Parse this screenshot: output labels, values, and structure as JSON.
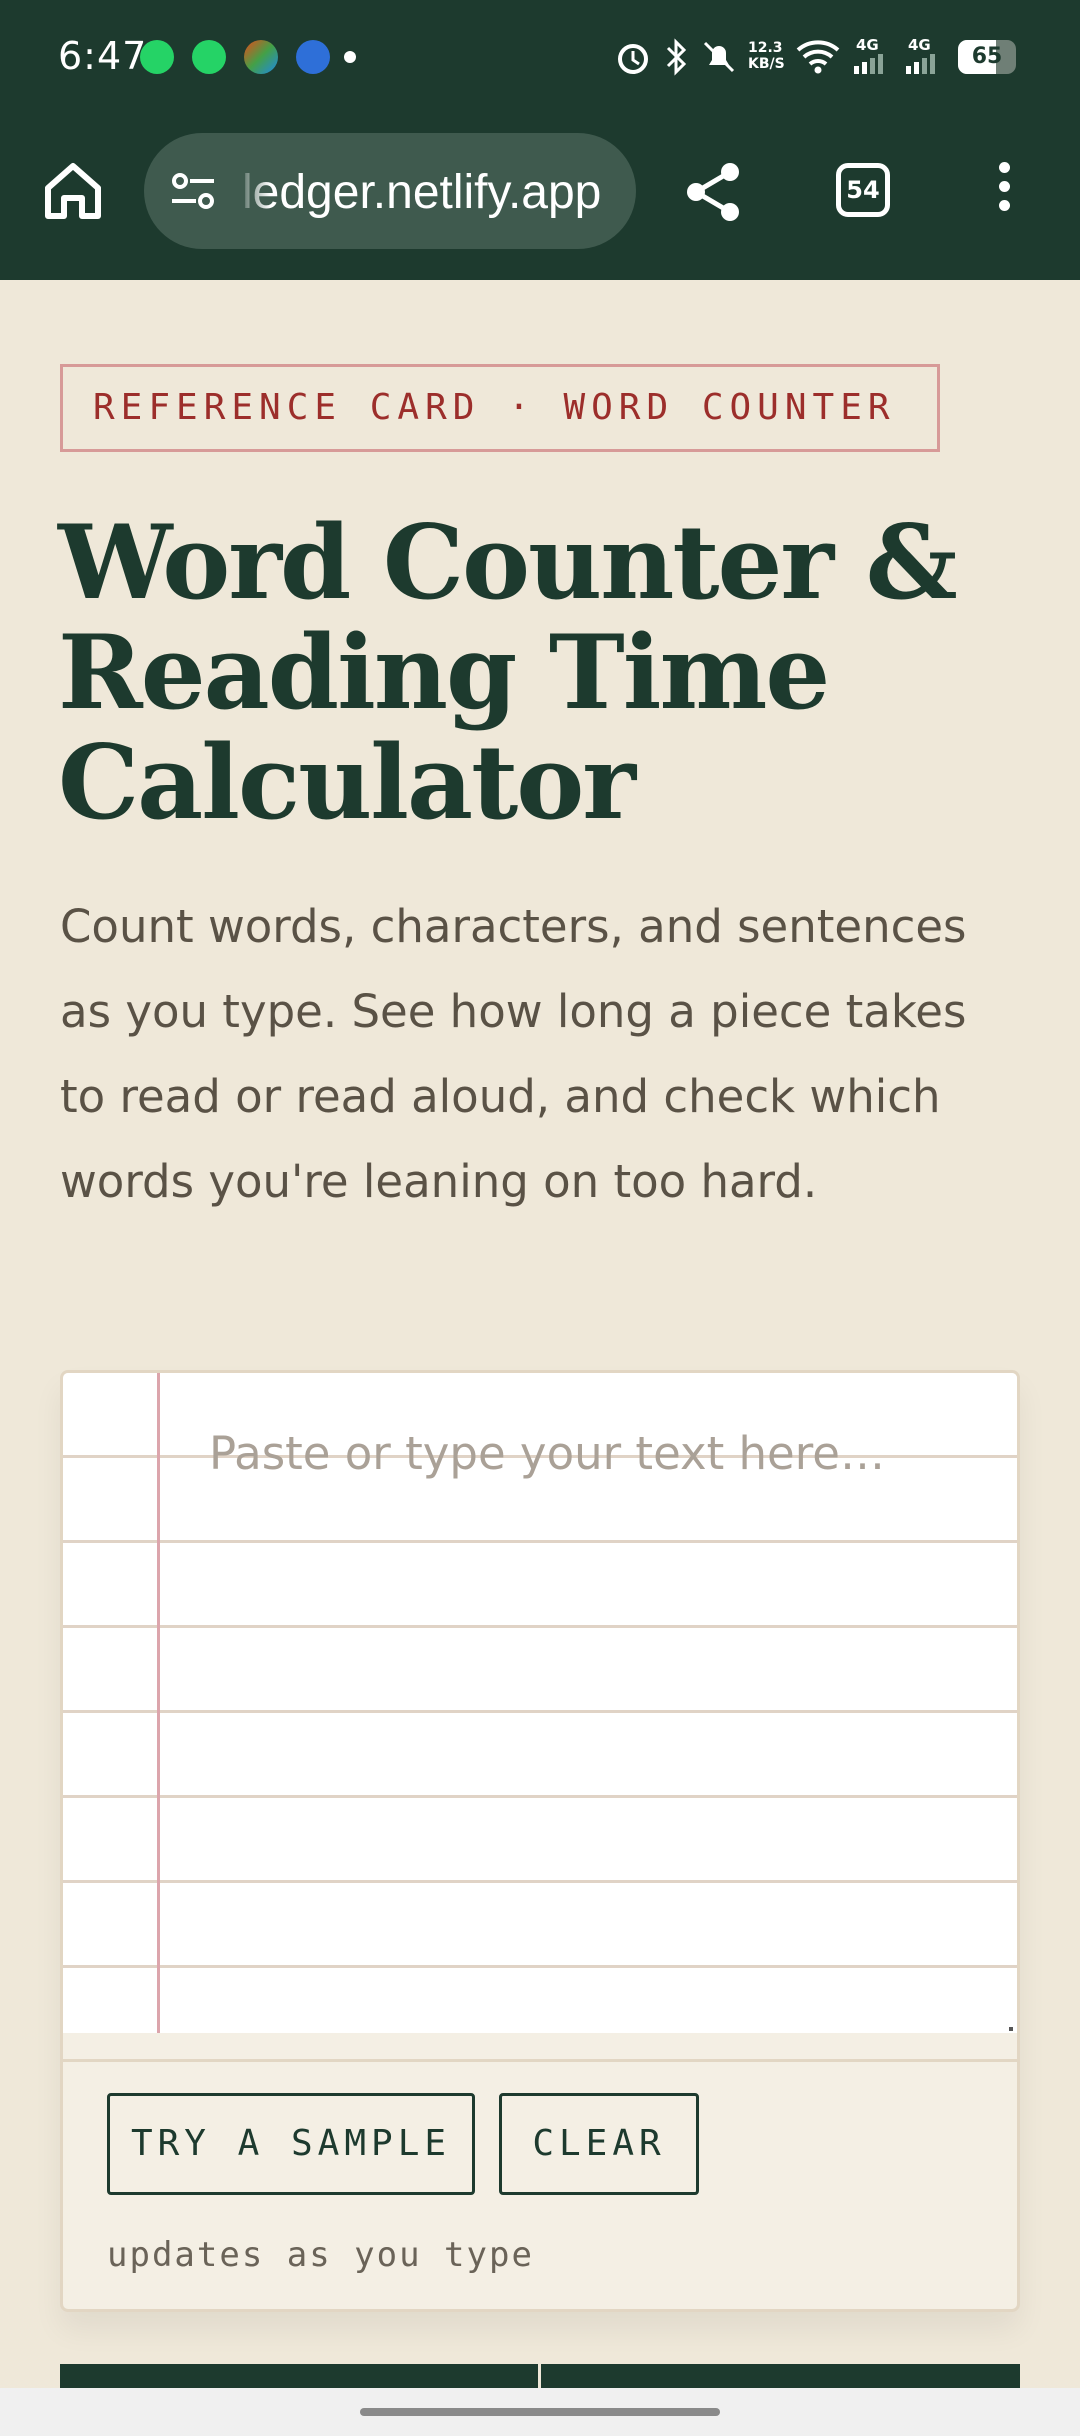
{
  "status_bar": {
    "time": "6:47",
    "notification_icons": [
      "whatsapp-icon",
      "whatsapp-icon",
      "office-icon",
      "phone-call-icon"
    ],
    "network_speed": "12.3\nKB/S",
    "signal_1": "4G",
    "signal_2": "4G",
    "battery_percent": "65",
    "battery_level": 0.65
  },
  "browser": {
    "url": "ledger.netlify.app",
    "tab_count": "54"
  },
  "page": {
    "badge": "REFERENCE CARD · WORD COUNTER",
    "title": "Word Counter & Reading Time Calculator",
    "intro": "Count words, characters, and sentences as you type. See how long a piece takes to read or read aloud, and check which words you're leaning on too hard."
  },
  "editor": {
    "placeholder": "Paste or type your text here…",
    "value": "",
    "try_sample_label": "TRY A SAMPLE",
    "clear_label": "CLEAR",
    "hint": "updates as you type"
  },
  "colors": {
    "brand_dark": "#1d3a2e",
    "accent_red": "#9c2e2b",
    "page_bg": "#efe8d9"
  }
}
